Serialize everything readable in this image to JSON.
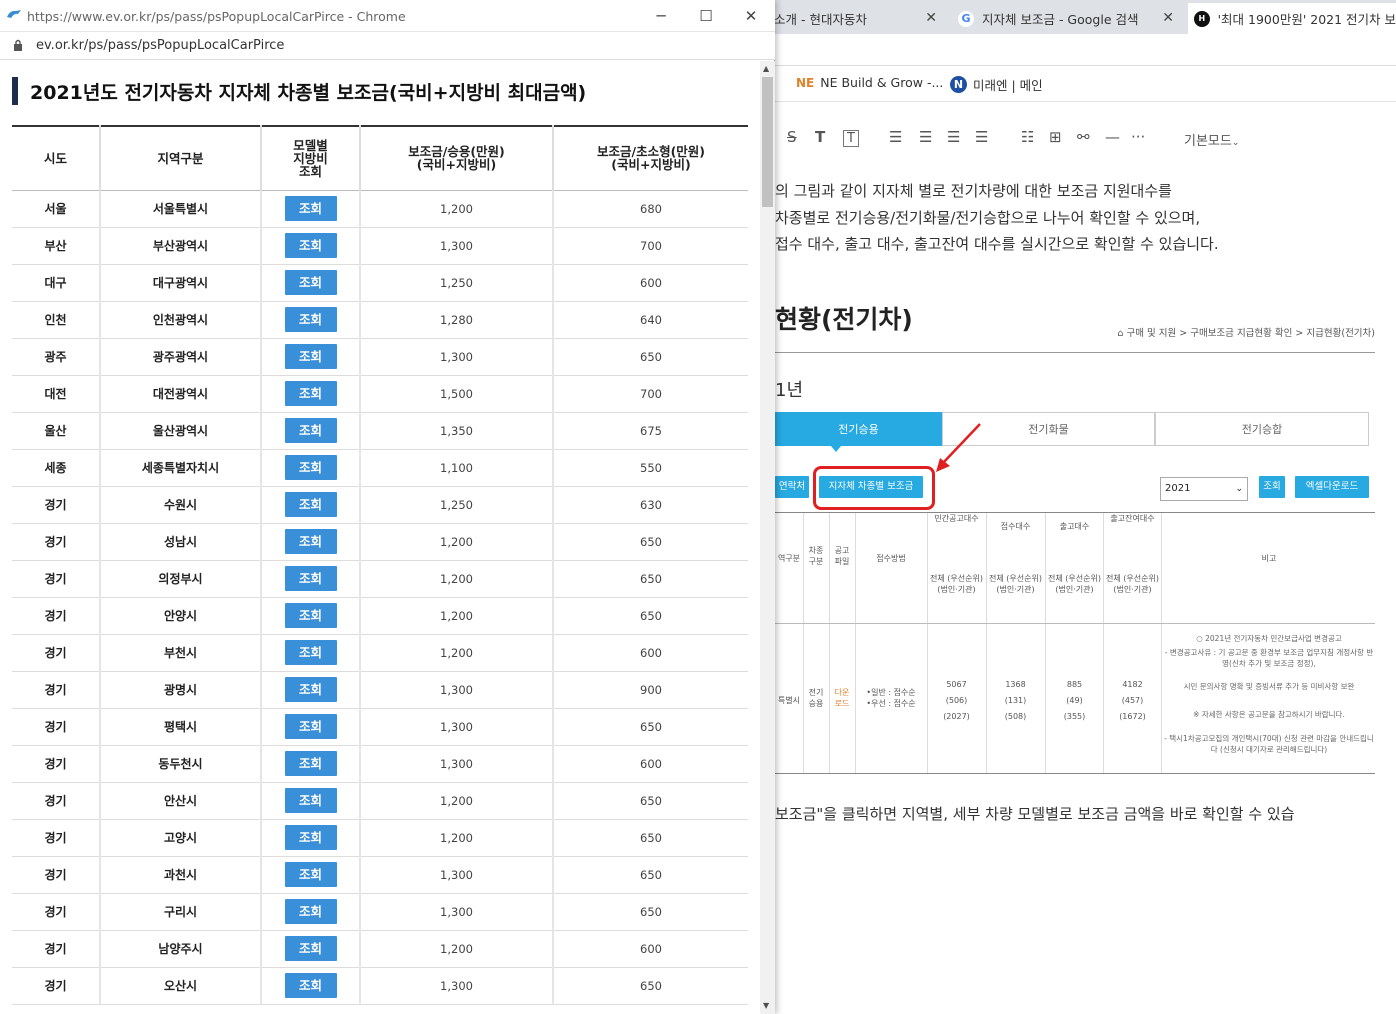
{
  "background": {
    "tabs": [
      {
        "label": "소개 - 현대자동차",
        "favicon": "none"
      },
      {
        "label": "지자체 보조금 - Google 검색",
        "favicon": "google-icon"
      },
      {
        "label": "'최대 1900만원' 2021 전기차 보",
        "favicon": "hd-icon"
      }
    ],
    "bookmarks": [
      {
        "label": "NE Build & Grow -...",
        "icon": "NE"
      },
      {
        "label": "미래엔 | 메인",
        "icon": "N"
      }
    ],
    "toolbar": {
      "mode_label": "기본모드"
    },
    "paragraphs": [
      "의 그림과 같이 지자체 별로 전기차량에 대한 보조금 지원대수를",
      "차종별로 전기승용/전기화물/전기승합으로 나누어 확인할 수 있으며,",
      "접수 대수, 출고 대수, 출고잔여 대수를 실시간으로 확인할 수 있습니다."
    ],
    "screenshot": {
      "title": "현황(전기차)",
      "breadcrumb": "구매 및 지원 > 구매보조금 지급현황 확인 > 지급현황(전기차)",
      "year_label": "1년",
      "tabs": [
        "전기승용",
        "전기화물",
        "전기승합"
      ],
      "btn_contact": "연락처",
      "btn_region_subsidy": "지자체 차종별 보조금",
      "select_year": "2021",
      "btn_search": "조회",
      "btn_excel": "엑셀다운로드",
      "headers": [
        "역구분",
        "차종구분",
        "공고파일",
        "접수방법",
        "민간공고대수",
        "접수대수",
        "출고대수",
        "출고잔여대수",
        "비고"
      ],
      "subheader": "전체 (우선순위) (법인·기관)",
      "row": {
        "region": "특별시",
        "type": "전기승용",
        "file": "다운로드",
        "method": "•일반 : 접수순\n•우선 : 접수순",
        "notice": "5067\n(506)\n(2027)",
        "received": "1368\n(131)\n(508)",
        "released": "885\n(49)\n(355)",
        "remaining": "4182\n(457)\n(1672)"
      },
      "notes": [
        "○ 2021년 전기자동차 민간보급사업 변경공고",
        "- 변경공고사유 : 기 공고문 중 환경부 보조금 업무지침 개정사항 반영(신차 추가 및 보조금 정정),",
        "시민 문의사항 명확 및 증빙서류 추가 등 미비사항 보완",
        "※ 자세한 사항은 공고문을 참고하시기 바랍니다.",
        "- 택시1차공고모집의 개인택시(70대) 신청 관련 마감을 안내드립니다 (신청시 대기자로 관리해드립니다)"
      ]
    },
    "footer_text": "보조금\"을 클릭하면 지역별, 세부 차량 모델별로 보조금 금액을 바로 확인할 수 있습"
  },
  "popup": {
    "window_title": "https://www.ev.or.kr/ps/pass/psPopupLocalCarPirce - Chrome",
    "url": "ev.or.kr/ps/pass/psPopupLocalCarPirce",
    "heading": "2021년도 전기자동차 지자체 차종별 보조금(국비+지방비 최대금액)",
    "columns": [
      "시도",
      "지역구분",
      "모델별\n지방비\n조회",
      "보조금/승용(만원)\n(국비+지방비)",
      "보조금/초소형(만원)\n(국비+지방비)"
    ],
    "lookup_label": "조회",
    "rows": [
      {
        "sido": "서울",
        "region": "서울특별시",
        "car": "1,200",
        "micro": "680"
      },
      {
        "sido": "부산",
        "region": "부산광역시",
        "car": "1,300",
        "micro": "700"
      },
      {
        "sido": "대구",
        "region": "대구광역시",
        "car": "1,250",
        "micro": "600"
      },
      {
        "sido": "인천",
        "region": "인천광역시",
        "car": "1,280",
        "micro": "640"
      },
      {
        "sido": "광주",
        "region": "광주광역시",
        "car": "1,300",
        "micro": "650"
      },
      {
        "sido": "대전",
        "region": "대전광역시",
        "car": "1,500",
        "micro": "700"
      },
      {
        "sido": "울산",
        "region": "울산광역시",
        "car": "1,350",
        "micro": "675"
      },
      {
        "sido": "세종",
        "region": "세종특별자치시",
        "car": "1,100",
        "micro": "550"
      },
      {
        "sido": "경기",
        "region": "수원시",
        "car": "1,250",
        "micro": "630"
      },
      {
        "sido": "경기",
        "region": "성남시",
        "car": "1,200",
        "micro": "650"
      },
      {
        "sido": "경기",
        "region": "의정부시",
        "car": "1,200",
        "micro": "650"
      },
      {
        "sido": "경기",
        "region": "안양시",
        "car": "1,200",
        "micro": "650"
      },
      {
        "sido": "경기",
        "region": "부천시",
        "car": "1,200",
        "micro": "600"
      },
      {
        "sido": "경기",
        "region": "광명시",
        "car": "1,300",
        "micro": "900"
      },
      {
        "sido": "경기",
        "region": "평택시",
        "car": "1,300",
        "micro": "650"
      },
      {
        "sido": "경기",
        "region": "동두천시",
        "car": "1,300",
        "micro": "600"
      },
      {
        "sido": "경기",
        "region": "안산시",
        "car": "1,200",
        "micro": "650"
      },
      {
        "sido": "경기",
        "region": "고양시",
        "car": "1,200",
        "micro": "650"
      },
      {
        "sido": "경기",
        "region": "과천시",
        "car": "1,300",
        "micro": "650"
      },
      {
        "sido": "경기",
        "region": "구리시",
        "car": "1,300",
        "micro": "650"
      },
      {
        "sido": "경기",
        "region": "남양주시",
        "car": "1,200",
        "micro": "600"
      },
      {
        "sido": "경기",
        "region": "오산시",
        "car": "1,300",
        "micro": "650"
      }
    ]
  },
  "colors": {
    "lookup_button": "#3a8fd9",
    "accent_blue": "#27a9e1",
    "highlight_red": "#e02020",
    "heading_bar": "#1f2d4d"
  }
}
